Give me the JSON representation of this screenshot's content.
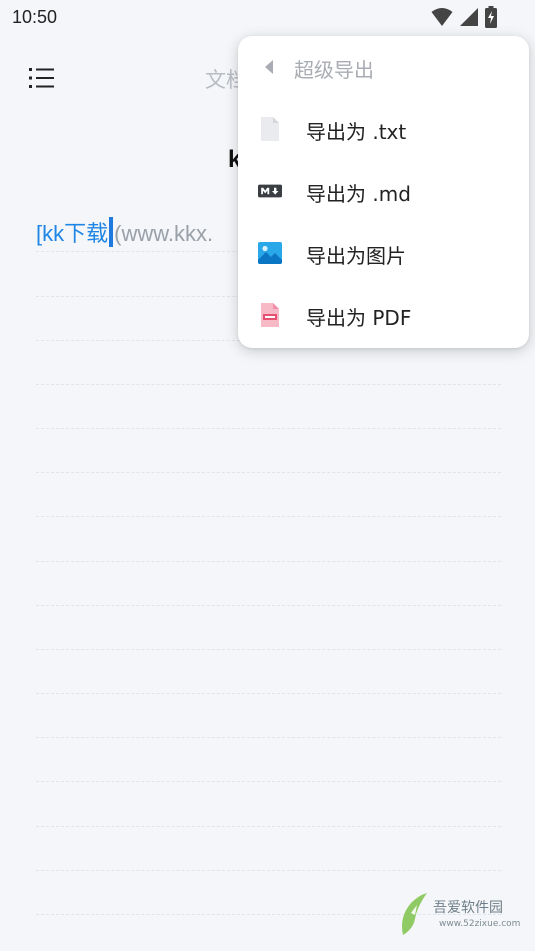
{
  "status_bar": {
    "time": "10:50"
  },
  "toolbar": {
    "title": "文档"
  },
  "document": {
    "heading": "k",
    "link_text": "[kk下载",
    "url_text": "(www.kkx."
  },
  "export_menu": {
    "header": "超级导出",
    "items": [
      {
        "label": "导出为 .txt",
        "icon": "text-file-icon"
      },
      {
        "label": "导出为 .md",
        "icon": "markdown-icon"
      },
      {
        "label": "导出为图片",
        "icon": "image-icon"
      },
      {
        "label": "导出为 PDF",
        "icon": "pdf-file-icon"
      }
    ]
  },
  "watermark": {
    "text": "吾爱软件园",
    "sub": "www.52zixue.com"
  },
  "colors": {
    "accent": "#1f86e6",
    "background": "#f4f6f9",
    "menu_bg": "#ffffff",
    "muted_text": "#a9adb3"
  }
}
